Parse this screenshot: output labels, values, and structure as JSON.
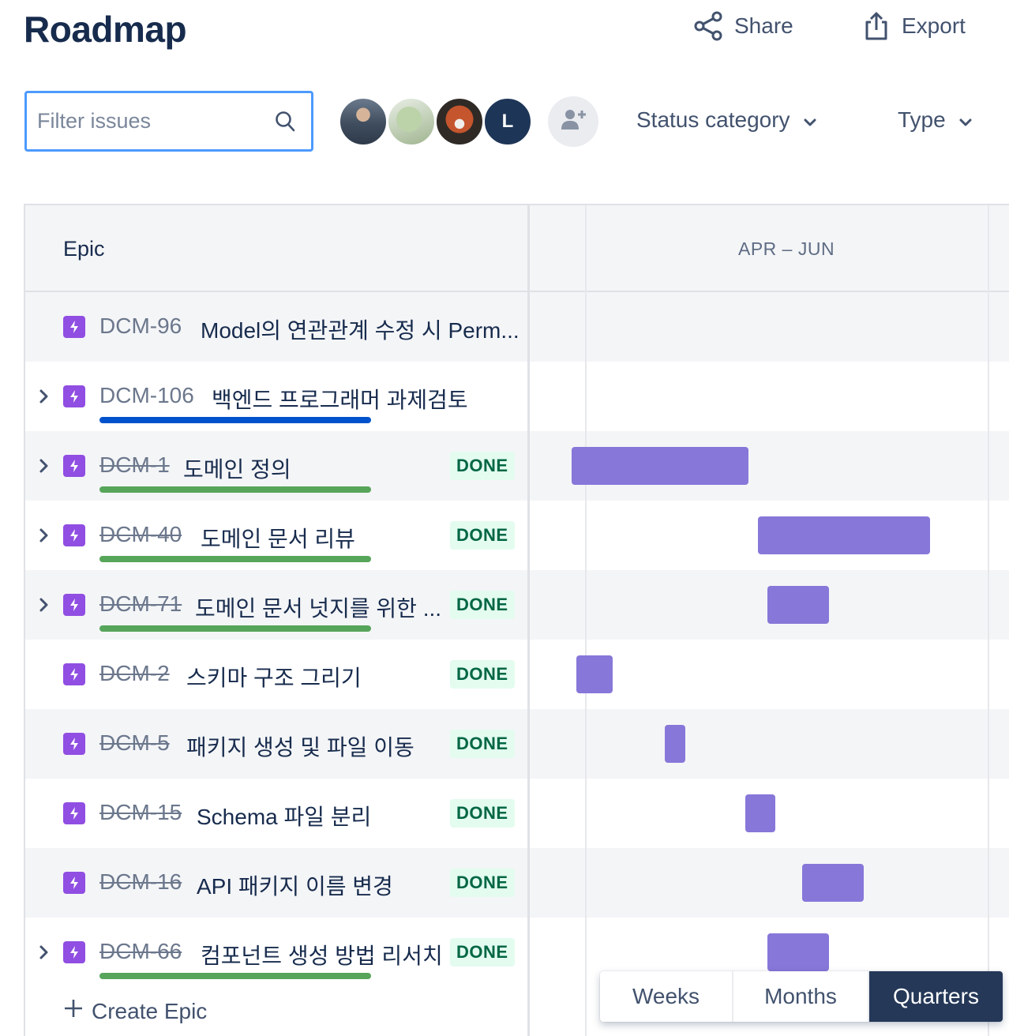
{
  "header": {
    "title": "Roadmap",
    "share_label": "Share",
    "export_label": "Export"
  },
  "filters": {
    "search_placeholder": "Filter issues",
    "avatar_initial": "L",
    "status_category_label": "Status category",
    "type_label": "Type"
  },
  "grid": {
    "epic_column_label": "Epic",
    "quarter_label": "APR – JUN"
  },
  "epics": [
    {
      "key": "DCM-96",
      "title": "Model의 연관관계 수정 시 Perm...",
      "expandable": false,
      "done": false,
      "status": "",
      "progress": null
    },
    {
      "key": "DCM-106",
      "title": "백엔드 프로그래머 과제검토",
      "expandable": true,
      "done": false,
      "status": "",
      "progress": "blue"
    },
    {
      "key": "DCM-1",
      "title": "도메인 정의",
      "expandable": true,
      "done": true,
      "status": "DONE",
      "progress": "green"
    },
    {
      "key": "DCM-40",
      "title": "도메인 문서 리뷰",
      "expandable": true,
      "done": true,
      "status": "DONE",
      "progress": "green"
    },
    {
      "key": "DCM-71",
      "title": "도메인 문서 넛지를 위한 ...",
      "expandable": true,
      "done": true,
      "status": "DONE",
      "progress": "green"
    },
    {
      "key": "DCM-2",
      "title": "스키마 구조 그리기",
      "expandable": false,
      "done": true,
      "status": "DONE",
      "progress": null
    },
    {
      "key": "DCM-5",
      "title": "패키지 생성 및 파일 이동",
      "expandable": false,
      "done": true,
      "status": "DONE",
      "progress": null
    },
    {
      "key": "DCM-15",
      "title": "Schema 파일 분리",
      "expandable": false,
      "done": true,
      "status": "DONE",
      "progress": null
    },
    {
      "key": "DCM-16",
      "title": "API 패키지 이름 변경",
      "expandable": false,
      "done": true,
      "status": "DONE",
      "progress": null
    },
    {
      "key": "DCM-66",
      "title": "컴포넌트 생성 방법 리서치",
      "expandable": true,
      "done": true,
      "status": "DONE",
      "progress": "green"
    }
  ],
  "create_epic_label": "Create Epic",
  "view_switch": {
    "options": [
      "Weeks",
      "Months",
      "Quarters"
    ],
    "selected": "Quarters"
  },
  "colors": {
    "epic_icon": "#904ee2",
    "timeline_bar": "#8777d9",
    "progress_in_progress": "#0052cc",
    "progress_done": "#57a55a",
    "done_badge_bg": "#e3fcef",
    "done_badge_text": "#006644"
  }
}
